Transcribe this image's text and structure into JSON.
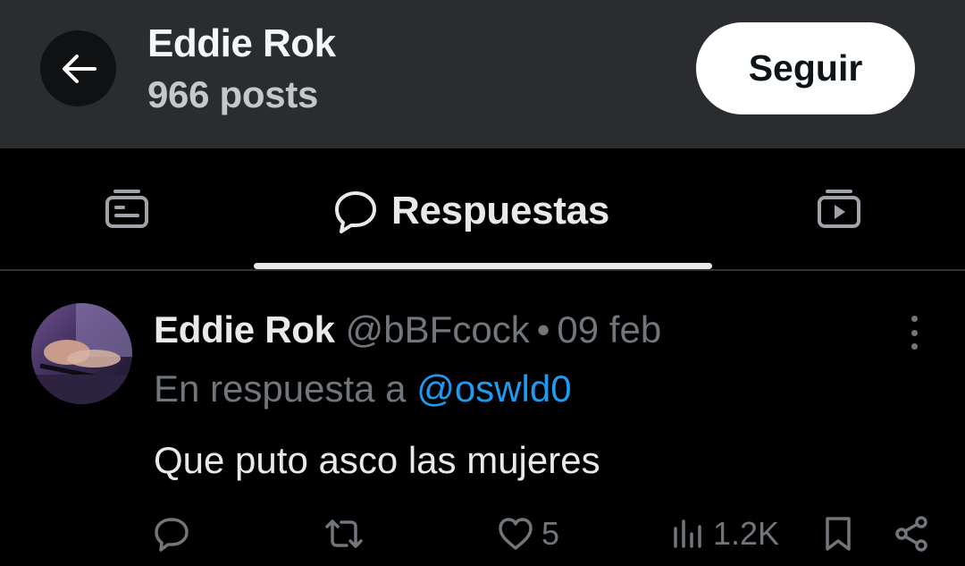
{
  "header": {
    "name": "Eddie Rok",
    "post_count": "966 posts",
    "follow_label": "Seguir"
  },
  "tabs": {
    "active_label": "Respuestas",
    "items": [
      "posts-icon",
      "replies-icon",
      "media-icon"
    ]
  },
  "post": {
    "author": "Eddie Rok",
    "handle": "@bBFcock",
    "separator": "•",
    "date": "09 feb",
    "reply_prefix": "En respuesta a",
    "reply_to": "@oswld0",
    "text": "Que puto asco las mujeres",
    "likes": "5",
    "views": "1.2K"
  },
  "colors": {
    "header_bg": "#2a2c30",
    "background": "#000000",
    "text_primary": "#e7e9ea",
    "text_secondary": "#71767b",
    "link": "#1d9bf0",
    "button_bg": "#ffffff"
  }
}
